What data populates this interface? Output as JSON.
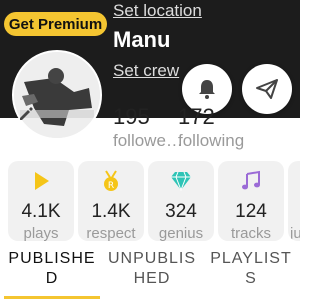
{
  "header": {
    "premium_label": "Get Premium",
    "set_location": "Set location",
    "name": "Manu",
    "set_crew": "Set crew"
  },
  "stats": {
    "followers_count": "195",
    "followers_label": "followe…",
    "following_count": "172",
    "following_label": "following"
  },
  "cards": [
    {
      "icon": "play-icon",
      "value": "4.1K",
      "label": "plays"
    },
    {
      "icon": "respect-medal-icon",
      "value": "1.4K",
      "label": "respect"
    },
    {
      "icon": "diamond-icon",
      "value": "324",
      "label": "genius"
    },
    {
      "icon": "music-note-icon",
      "value": "124",
      "label": "tracks"
    },
    {
      "label": "ju"
    }
  ],
  "tabs": [
    {
      "label": "PUBLISHED",
      "active": true
    },
    {
      "label": "UNPUBLISHED",
      "active": false
    },
    {
      "label": "PLAYLISTS",
      "active": false
    }
  ],
  "colors": {
    "accent": "#f4c531",
    "header_bg": "#1c1c1c",
    "play": "#f5c518",
    "diamond": "#2ec4b6",
    "music": "#9b6bd6"
  }
}
